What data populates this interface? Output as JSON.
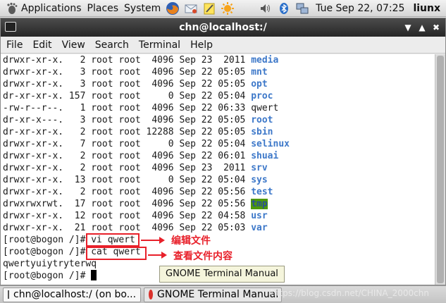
{
  "top_panel": {
    "applications": "Applications",
    "places": "Places",
    "system": "System",
    "launchers": [
      "firefox-icon",
      "mail-icon",
      "notes-icon",
      "weather-icon",
      "volume-icon",
      "bluetooth-icon",
      "network-icon"
    ],
    "clock": "Tue Sep 22, 07:25",
    "user": "liunx"
  },
  "window": {
    "title": "chn@localhost:/",
    "menu": [
      "File",
      "Edit",
      "View",
      "Search",
      "Terminal",
      "Help"
    ]
  },
  "listing": [
    {
      "perms": "drwxr-xr-x.",
      "links": "2",
      "owner": "root",
      "group": "root",
      "size": "4096",
      "date": "Sep 23  2011",
      "name": "media",
      "kind": "dir"
    },
    {
      "perms": "drwxr-xr-x.",
      "links": "3",
      "owner": "root",
      "group": "root",
      "size": "4096",
      "date": "Sep 22 05:05",
      "name": "mnt",
      "kind": "dir"
    },
    {
      "perms": "drwxr-xr-x.",
      "links": "3",
      "owner": "root",
      "group": "root",
      "size": "4096",
      "date": "Sep 22 05:05",
      "name": "opt",
      "kind": "dir"
    },
    {
      "perms": "dr-xr-xr-x.",
      "links": "157",
      "owner": "root",
      "group": "root",
      "size": "0",
      "date": "Sep 22 05:04",
      "name": "proc",
      "kind": "dir"
    },
    {
      "perms": "-rw-r--r--.",
      "links": "1",
      "owner": "root",
      "group": "root",
      "size": "4096",
      "date": "Sep 22 06:33",
      "name": "qwert",
      "kind": "file"
    },
    {
      "perms": "dr-xr-x---.",
      "links": "3",
      "owner": "root",
      "group": "root",
      "size": "4096",
      "date": "Sep 22 05:05",
      "name": "root",
      "kind": "dir"
    },
    {
      "perms": "dr-xr-xr-x.",
      "links": "2",
      "owner": "root",
      "group": "root",
      "size": "12288",
      "date": "Sep 22 05:05",
      "name": "sbin",
      "kind": "dir"
    },
    {
      "perms": "drwxr-xr-x.",
      "links": "7",
      "owner": "root",
      "group": "root",
      "size": "0",
      "date": "Sep 22 05:04",
      "name": "selinux",
      "kind": "dir"
    },
    {
      "perms": "drwxr-xr-x.",
      "links": "2",
      "owner": "root",
      "group": "root",
      "size": "4096",
      "date": "Sep 22 06:01",
      "name": "shuai",
      "kind": "dir"
    },
    {
      "perms": "drwxr-xr-x.",
      "links": "2",
      "owner": "root",
      "group": "root",
      "size": "4096",
      "date": "Sep 23  2011",
      "name": "srv",
      "kind": "dir"
    },
    {
      "perms": "drwxr-xr-x.",
      "links": "13",
      "owner": "root",
      "group": "root",
      "size": "0",
      "date": "Sep 22 05:04",
      "name": "sys",
      "kind": "dir"
    },
    {
      "perms": "drwxr-xr-x.",
      "links": "2",
      "owner": "root",
      "group": "root",
      "size": "4096",
      "date": "Sep 22 05:56",
      "name": "test",
      "kind": "dir"
    },
    {
      "perms": "drwxrwxrwt.",
      "links": "17",
      "owner": "root",
      "group": "root",
      "size": "4096",
      "date": "Sep 22 05:56",
      "name": "tmp",
      "kind": "sticky"
    },
    {
      "perms": "drwxr-xr-x.",
      "links": "12",
      "owner": "root",
      "group": "root",
      "size": "4096",
      "date": "Sep 22 04:58",
      "name": "usr",
      "kind": "dir"
    },
    {
      "perms": "drwxr-xr-x.",
      "links": "21",
      "owner": "root",
      "group": "root",
      "size": "4096",
      "date": "Sep 22 05:03",
      "name": "var",
      "kind": "dir"
    }
  ],
  "commands": {
    "prompt": "[root@bogon /]#",
    "cmd1": "vi qwert",
    "cmd2": "cat qwert",
    "output": "qwertyuiytryterwq"
  },
  "annotations": {
    "label1": "编辑文件",
    "label2": "查看文件内容",
    "color": "#e8202a"
  },
  "tooltip": "GNOME Terminal Manual",
  "taskbar": {
    "task1": "chn@localhost:/ (on bo...",
    "task2": "GNOME Terminal Manual",
    "watermark": "https://blog.csdn.net/CHINA_2000chn"
  }
}
